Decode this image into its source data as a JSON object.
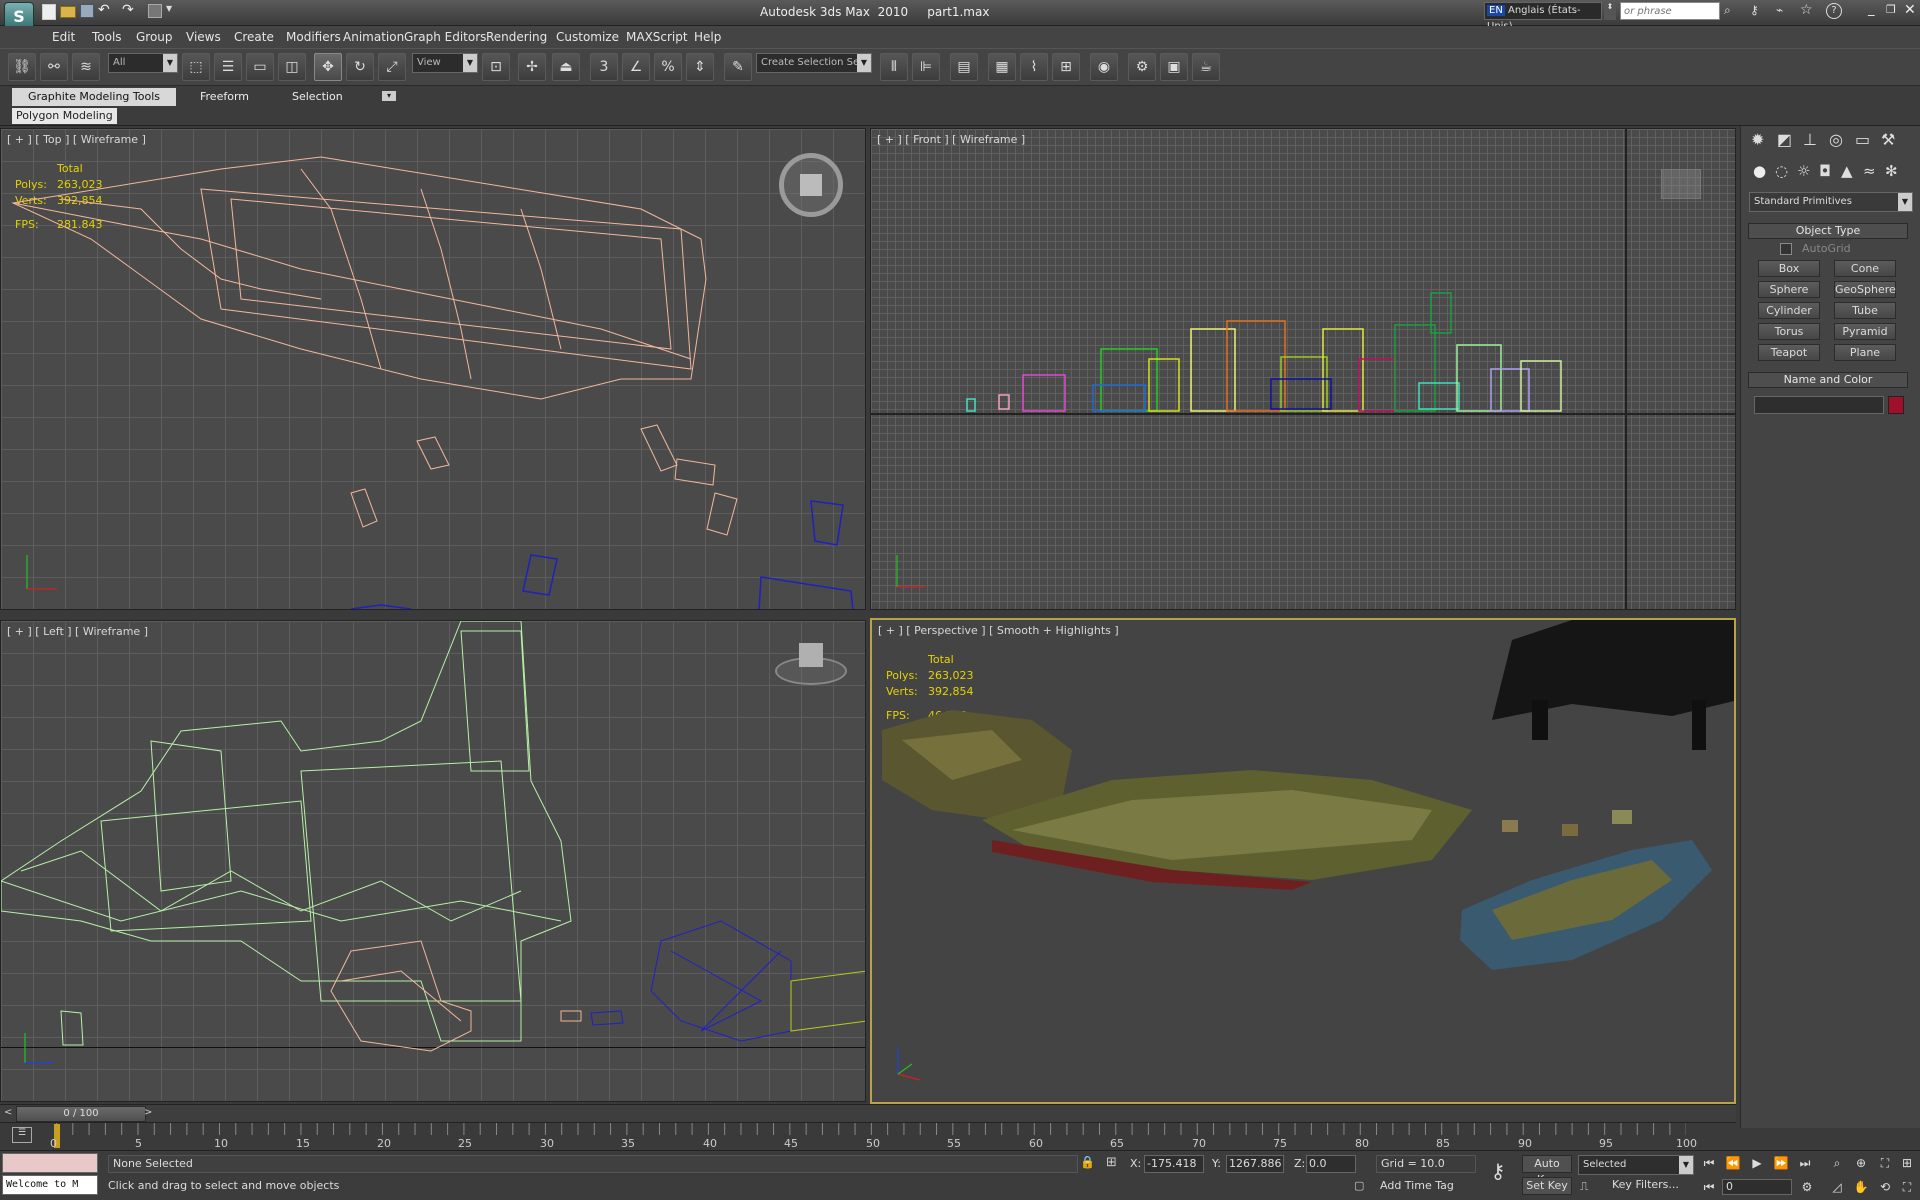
{
  "title": {
    "app": "Autodesk 3ds Max  2010",
    "file": "part1.max"
  },
  "infocenter": {
    "lang_code": "EN",
    "lang_name": "Anglais (États-Unis)",
    "search_placeholder": "or phrase"
  },
  "menu": [
    "Edit",
    "Tools",
    "Group",
    "Views",
    "Create",
    "Modifiers",
    "Animation",
    "Graph Editors",
    "Rendering",
    "Customize",
    "MAXScript",
    "Help"
  ],
  "toolbar": {
    "filter": "All",
    "ref_coord": "View",
    "selection_set": "Create Selection Se"
  },
  "ribbon": {
    "tabs": [
      "Graphite Modeling Tools",
      "Freeform",
      "Selection"
    ],
    "panel": "Polygon Modeling"
  },
  "viewports": {
    "top": {
      "label": "[ + ] [ Top ] [ Wireframe ]",
      "stats": {
        "total": "Total",
        "polys_label": "Polys:",
        "polys": "263,023",
        "verts_label": "Verts:",
        "verts": "392,854",
        "fps_label": "FPS:",
        "fps": "281.843"
      }
    },
    "front": {
      "label": "[ + ] [ Front ] [ Wireframe ]"
    },
    "left": {
      "label": "[ + ] [ Left ] [ Wireframe ]"
    },
    "perspective": {
      "label": "[ + ] [ Perspective ] [ Smooth + Highlights ]",
      "stats": {
        "total": "Total",
        "polys_label": "Polys:",
        "polys": "263,023",
        "verts_label": "Verts:",
        "verts": "392,854",
        "fps_label": "FPS:",
        "fps": "46.156"
      }
    }
  },
  "command_panel": {
    "category": "Standard Primitives",
    "object_type_title": "Object Type",
    "autogrid": "AutoGrid",
    "buttons": [
      "Box",
      "Cone",
      "Sphere",
      "GeoSphere",
      "Cylinder",
      "Tube",
      "Torus",
      "Pyramid",
      "Teapot",
      "Plane"
    ],
    "name_color_title": "Name and Color",
    "object_color": "#a0102a"
  },
  "timeline": {
    "frame": "0 / 100",
    "ticks": [
      "0",
      "5",
      "10",
      "15",
      "20",
      "25",
      "30",
      "35",
      "40",
      "45",
      "50",
      "55",
      "60",
      "65",
      "70",
      "75",
      "80",
      "85",
      "90",
      "95",
      "100"
    ]
  },
  "status": {
    "listener": "Welcome to M",
    "selection": "None Selected",
    "prompt": "Click and drag to select and move objects",
    "x_label": "X:",
    "x": "-175.418",
    "y_label": "Y:",
    "y": "1267.886",
    "z_label": "Z:",
    "z": "0.0",
    "grid": "Grid = 10.0",
    "auto_key": "Auto Key",
    "set_key": "Set Key",
    "key_mode": "Selected",
    "key_filters": "Key Filters...",
    "add_time_tag": "Add Time Tag",
    "current_frame": "0"
  },
  "colors": {
    "accent_yellow": "#e5d300",
    "viewport_bg": "#4a4a4a",
    "active_border": "#b8a24a"
  }
}
